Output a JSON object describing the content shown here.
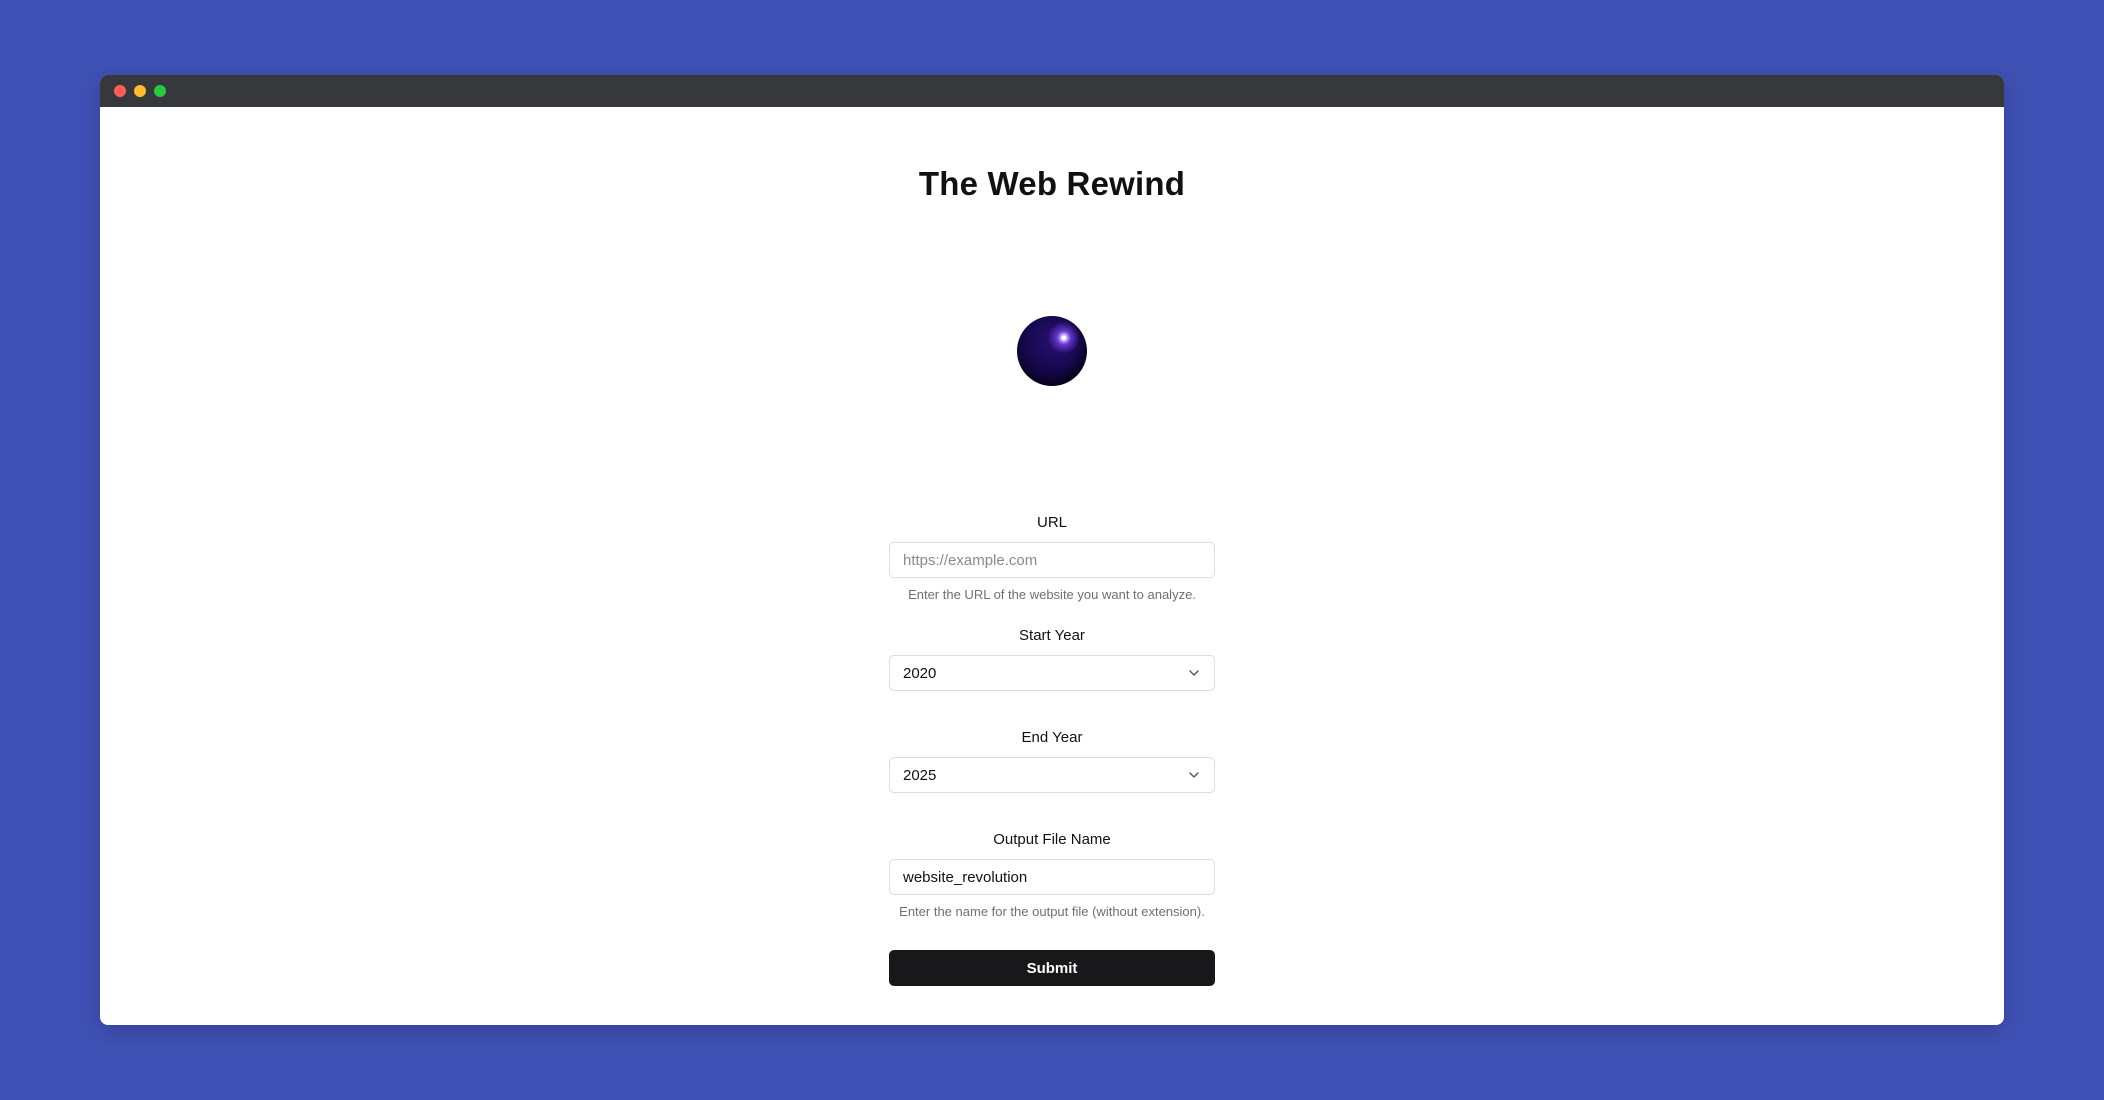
{
  "window": {
    "controls": [
      "close",
      "minimize",
      "maximize"
    ]
  },
  "page": {
    "title": "The Web Rewind"
  },
  "form": {
    "url": {
      "label": "URL",
      "placeholder": "https://example.com",
      "value": "",
      "hint": "Enter the URL of the website you want to analyze."
    },
    "start_year": {
      "label": "Start Year",
      "value": "2020"
    },
    "end_year": {
      "label": "End Year",
      "value": "2025"
    },
    "output_file": {
      "label": "Output File Name",
      "value": "website_revolution",
      "hint": "Enter the name for the output file (without extension)."
    },
    "submit_label": "Submit"
  },
  "colors": {
    "background": "#3f51b5",
    "titlebar": "#37383c",
    "button": "#18181b",
    "orb": "#170a52"
  },
  "icons": {
    "select_chevron": "chevron-down-icon",
    "hero": "orb-icon"
  }
}
